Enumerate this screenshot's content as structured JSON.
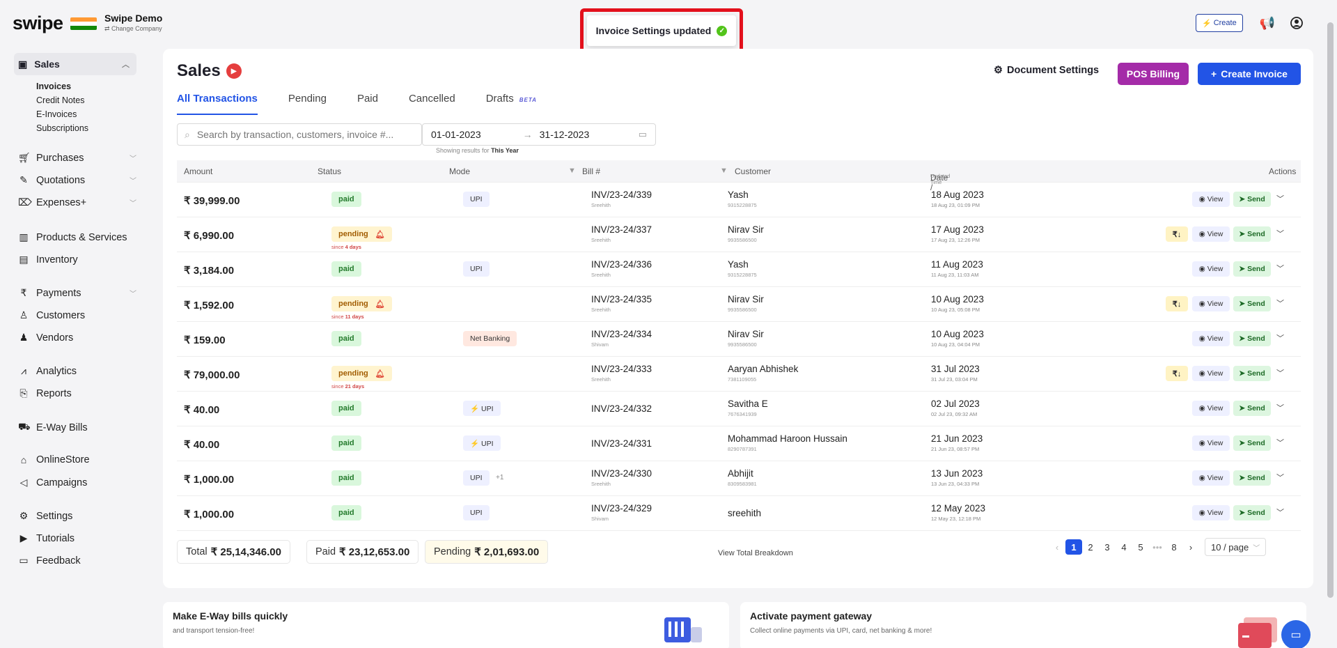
{
  "header": {
    "logo": "swipe",
    "company_name": "Swipe Demo",
    "change_company": "⇄ Change Company",
    "toast": "Invoice Settings updated",
    "create_label": "Create"
  },
  "sidebar": {
    "sales_label": "Sales",
    "sub_items": [
      "Invoices",
      "Credit Notes",
      "E-Invoices",
      "Subscriptions"
    ],
    "items": [
      {
        "label": "Purchases",
        "icon": "cart-icon",
        "chevron": true
      },
      {
        "label": "Quotations",
        "icon": "pen-icon",
        "chevron": true
      },
      {
        "label": "Expenses+",
        "icon": "tag-icon",
        "chevron": true
      },
      {
        "label": "Products & Services",
        "icon": "barcode-icon",
        "chevron": false
      },
      {
        "label": "Inventory",
        "icon": "warehouse-icon",
        "chevron": false
      },
      {
        "label": "Payments",
        "icon": "rupee-icon",
        "chevron": true
      },
      {
        "label": "Customers",
        "icon": "user-icon",
        "chevron": false
      },
      {
        "label": "Vendors",
        "icon": "users-icon",
        "chevron": false
      },
      {
        "label": "Analytics",
        "icon": "chart-icon",
        "chevron": false
      },
      {
        "label": "Reports",
        "icon": "report-icon",
        "chevron": false
      },
      {
        "label": "E-Way Bills",
        "icon": "truck-icon",
        "chevron": false
      },
      {
        "label": "OnlineStore",
        "icon": "store-icon",
        "chevron": false
      },
      {
        "label": "Campaigns",
        "icon": "megaphone-icon",
        "chevron": false
      },
      {
        "label": "Settings",
        "icon": "gear-icon",
        "chevron": false
      },
      {
        "label": "Tutorials",
        "icon": "youtube-icon",
        "chevron": false
      },
      {
        "label": "Feedback",
        "icon": "chat-icon",
        "chevron": false
      }
    ]
  },
  "page": {
    "title": "Sales",
    "document_settings": "Document Settings",
    "pos_billing": "POS Billing",
    "create_invoice": "Create Invoice",
    "tabs": [
      "All Transactions",
      "Pending",
      "Paid",
      "Cancelled",
      "Drafts"
    ],
    "beta": "BETA",
    "search_placeholder": "Search by transaction, customers, invoice #...",
    "date_from": "01-01-2023",
    "date_to": "31-12-2023",
    "showing_prefix": "Showing results for",
    "showing_range": "This Year"
  },
  "table": {
    "headers": {
      "amount": "Amount",
      "status": "Status",
      "mode": "Mode",
      "bill": "Bill #",
      "customer": "Customer",
      "date": "Date /",
      "date_sub": "Updated Time",
      "actions": "Actions"
    },
    "view_label": "View",
    "send_label": "Send",
    "rows": [
      {
        "amount": "₹ 39,999.00",
        "status": "paid",
        "since": "",
        "mode": "UPI",
        "mode_extra": "",
        "bill": "INV/23-24/339",
        "bill_sub": "Sreehith",
        "customer": "Yash",
        "customer_sub": "9315228875",
        "date": "18 Aug 2023",
        "date_sub": "18 Aug 23, 01:09 PM",
        "rupee": false
      },
      {
        "amount": "₹ 6,990.00",
        "status": "pending",
        "since": "4 days",
        "mode": "",
        "mode_extra": "",
        "bill": "INV/23-24/337",
        "bill_sub": "Sreehith",
        "customer": "Nirav Sir",
        "customer_sub": "9935586500",
        "date": "17 Aug 2023",
        "date_sub": "17 Aug 23, 12:26 PM",
        "rupee": true
      },
      {
        "amount": "₹ 3,184.00",
        "status": "paid",
        "since": "",
        "mode": "UPI",
        "mode_extra": "",
        "bill": "INV/23-24/336",
        "bill_sub": "Sreehith",
        "customer": "Yash",
        "customer_sub": "9315228875",
        "date": "11 Aug 2023",
        "date_sub": "11 Aug 23, 11:03 AM",
        "rupee": false
      },
      {
        "amount": "₹ 1,592.00",
        "status": "pending",
        "since": "11 days",
        "mode": "",
        "mode_extra": "",
        "bill": "INV/23-24/335",
        "bill_sub": "Sreehith",
        "customer": "Nirav Sir",
        "customer_sub": "9935586500",
        "date": "10 Aug 2023",
        "date_sub": "10 Aug 23, 05:08 PM",
        "rupee": true
      },
      {
        "amount": "₹ 159.00",
        "status": "paid",
        "since": "",
        "mode": "Net Banking",
        "mode_extra": "",
        "bill": "INV/23-24/334",
        "bill_sub": "Shivam",
        "customer": "Nirav Sir",
        "customer_sub": "9935586500",
        "date": "10 Aug 2023",
        "date_sub": "10 Aug 23, 04:04 PM",
        "rupee": false
      },
      {
        "amount": "₹ 79,000.00",
        "status": "pending",
        "since": "21 days",
        "mode": "",
        "mode_extra": "",
        "bill": "INV/23-24/333",
        "bill_sub": "Sreehith",
        "customer": "Aaryan Abhishek",
        "customer_sub": "7381109055",
        "date": "31 Jul 2023",
        "date_sub": "31 Jul 23, 03:04 PM",
        "rupee": true
      },
      {
        "amount": "₹ 40.00",
        "status": "paid",
        "since": "",
        "mode": "⚡ UPI",
        "mode_extra": "",
        "bill": "INV/23-24/332",
        "bill_sub": "",
        "customer": "Savitha E",
        "customer_sub": "7676341939",
        "date": "02 Jul 2023",
        "date_sub": "02 Jul 23, 09:32 AM",
        "rupee": false
      },
      {
        "amount": "₹ 40.00",
        "status": "paid",
        "since": "",
        "mode": "⚡ UPI",
        "mode_extra": "",
        "bill": "INV/23-24/331",
        "bill_sub": "",
        "customer": "Mohammad Haroon Hussain",
        "customer_sub": "8290787391",
        "date": "21 Jun 2023",
        "date_sub": "21 Jun 23, 08:57 PM",
        "rupee": false
      },
      {
        "amount": "₹ 1,000.00",
        "status": "paid",
        "since": "",
        "mode": "UPI",
        "mode_extra": "+1",
        "bill": "INV/23-24/330",
        "bill_sub": "Sreehith",
        "customer": "Abhijit",
        "customer_sub": "8309583981",
        "date": "13 Jun 2023",
        "date_sub": "13 Jun 23, 04:33 PM",
        "rupee": false
      },
      {
        "amount": "₹ 1,000.00",
        "status": "paid",
        "since": "",
        "mode": "UPI",
        "mode_extra": "",
        "bill": "INV/23-24/329",
        "bill_sub": "Shivam",
        "customer": "sreehith",
        "customer_sub": "",
        "date": "12 May 2023",
        "date_sub": "12 May 23, 12:18 PM",
        "rupee": false
      }
    ]
  },
  "totals": {
    "total_label": "Total",
    "total_value": "₹ 25,14,346.00",
    "paid_label": "Paid",
    "paid_value": "₹ 23,12,653.00",
    "pending_label": "Pending",
    "pending_value": "₹ 2,01,693.00",
    "breakdown": "View Total Breakdown"
  },
  "pagination": {
    "pages": [
      "1",
      "2",
      "3",
      "4",
      "5",
      "•••",
      "8"
    ],
    "current": "1",
    "per_page": "10 / page"
  },
  "promos": [
    {
      "title": "Make E-Way bills quickly",
      "subtitle": "and transport tension-free!"
    },
    {
      "title": "Activate payment gateway",
      "subtitle": "Collect online payments via UPI, card, net banking & more!"
    }
  ],
  "colors": {
    "primary": "#2254e6",
    "pos": "#a42ba8",
    "paid_bg": "#d9f7dc",
    "pending_bg": "#fff4cf",
    "toast_border": "#e3101c"
  }
}
